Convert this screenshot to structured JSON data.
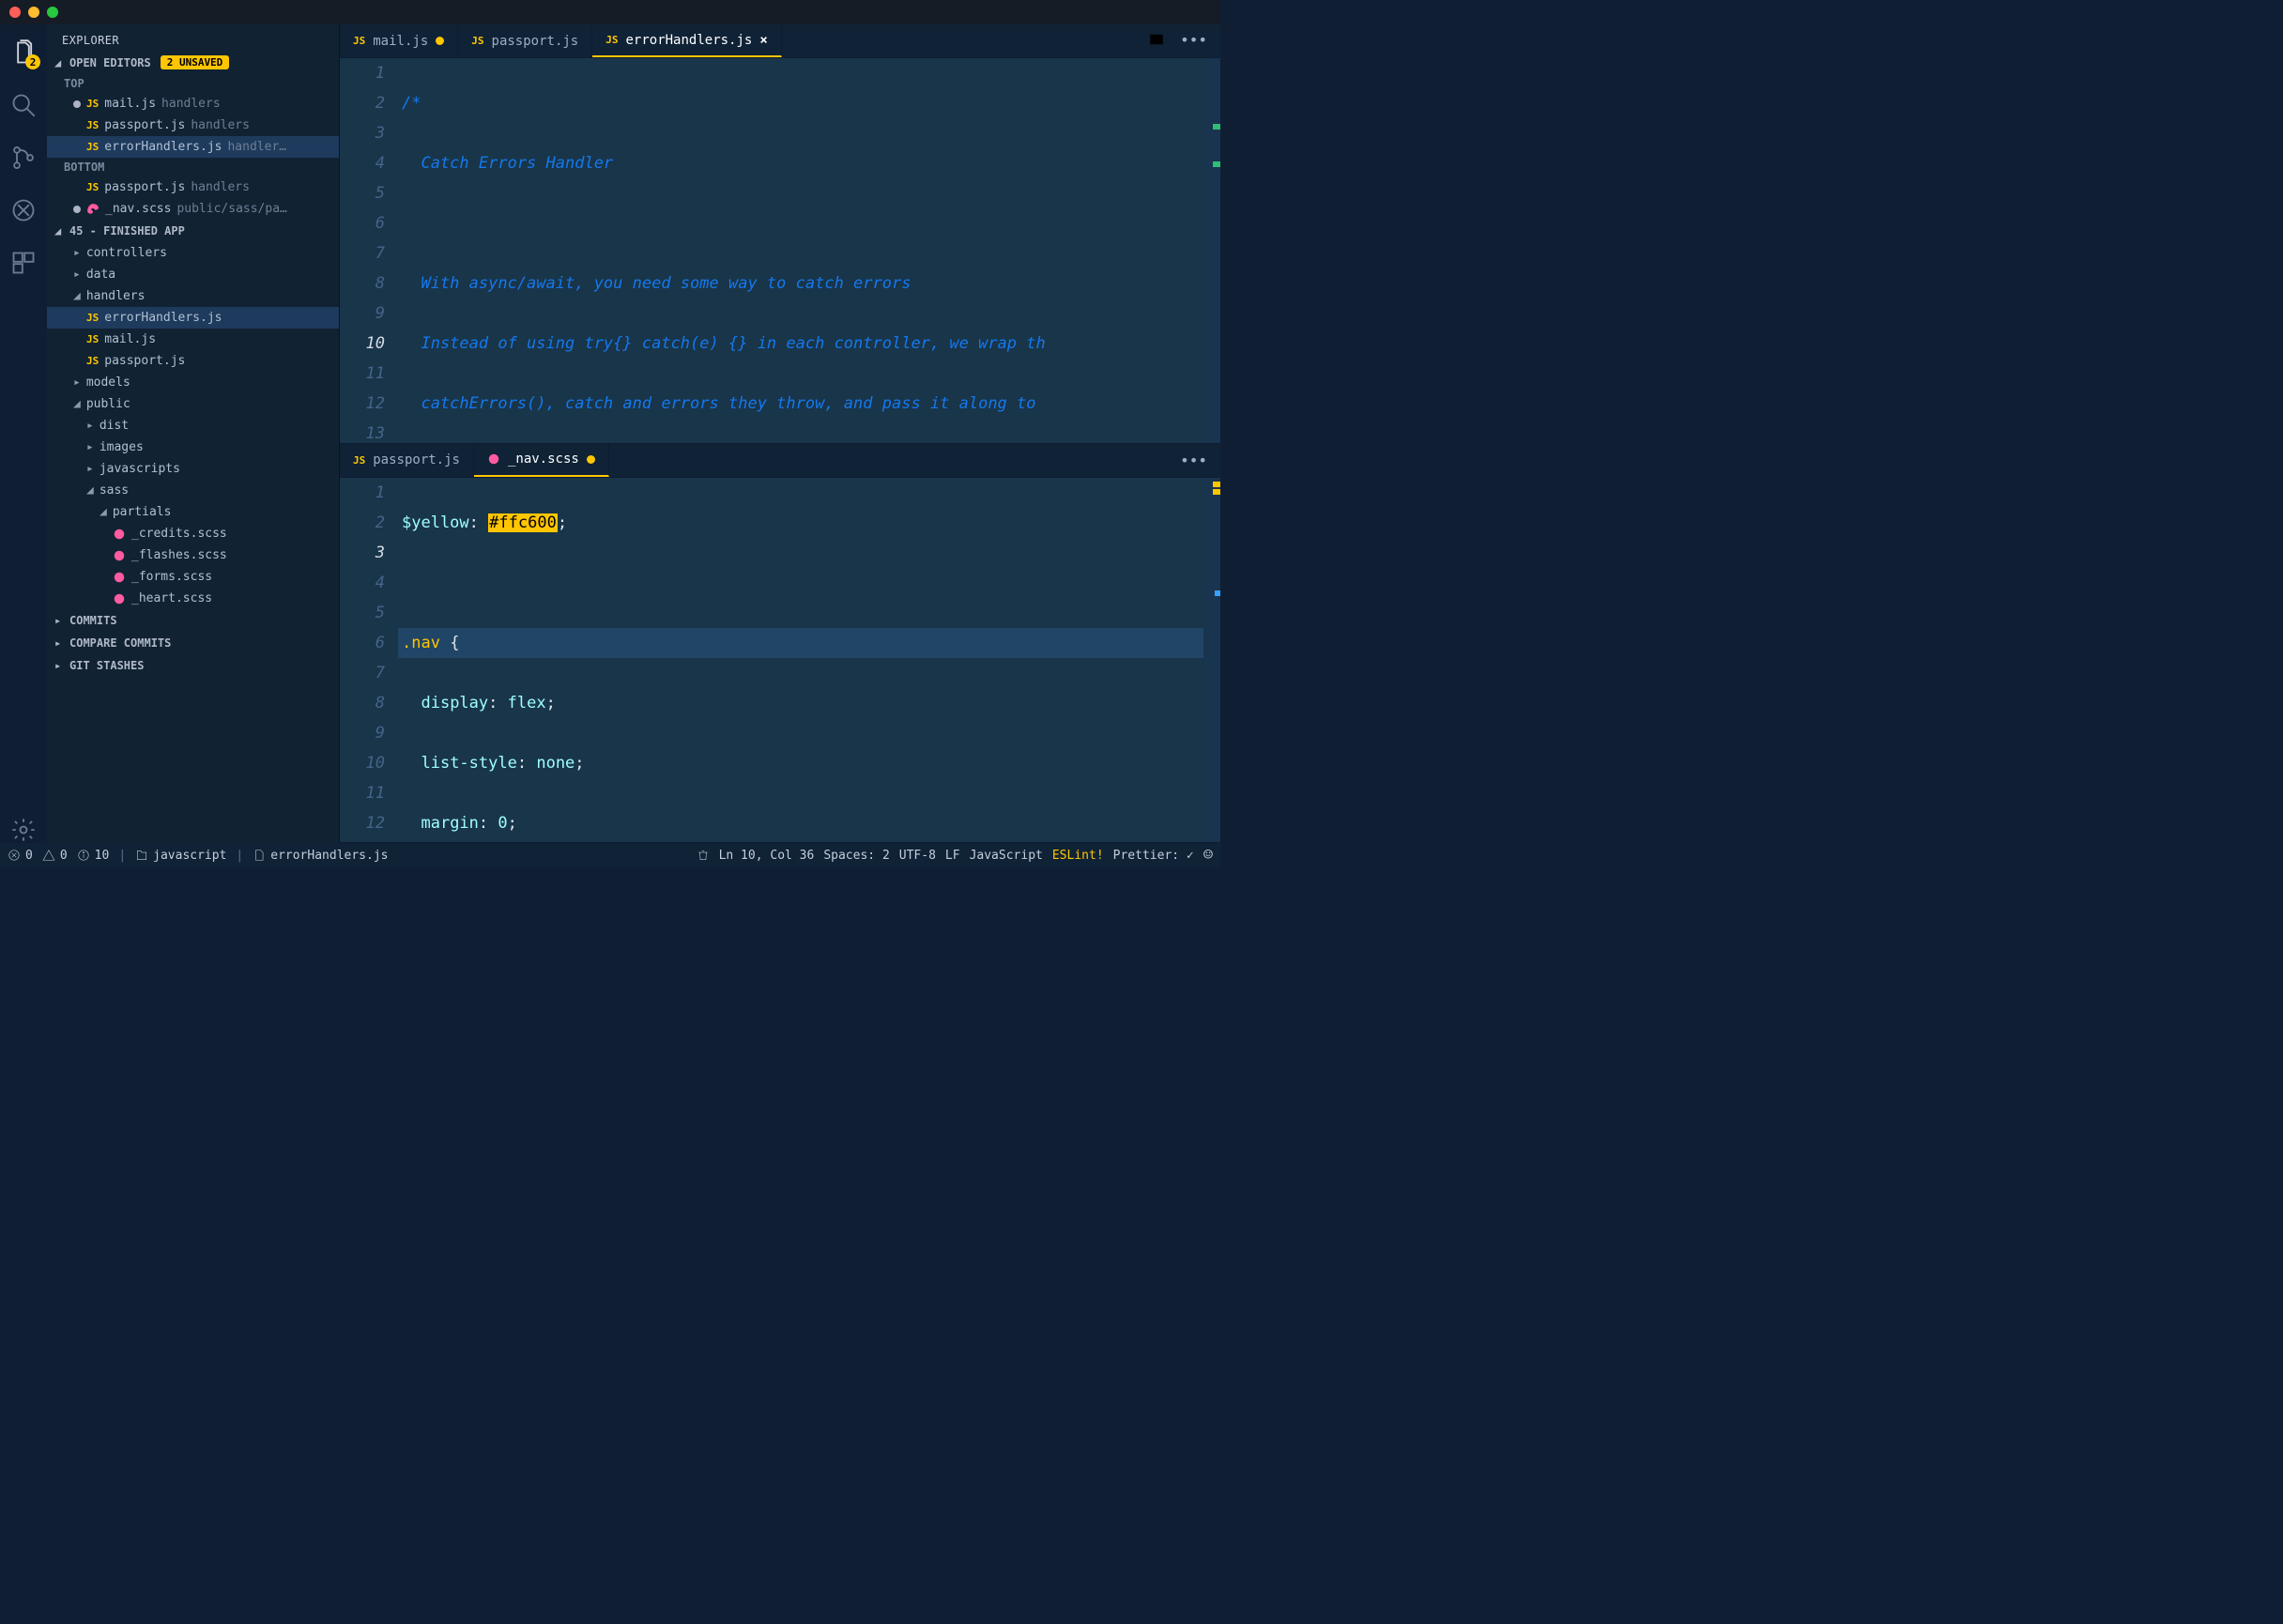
{
  "activity_badge": "2",
  "sidebar": {
    "title": "EXPLORER",
    "open_editors_label": "OPEN EDITORS",
    "unsaved_badge": "2 UNSAVED",
    "group_top_label": "TOP",
    "group_bottom_label": "BOTTOM",
    "open_editors": {
      "top": [
        {
          "file": "mail.js",
          "hint": "handlers",
          "dirty": true,
          "lang": "js"
        },
        {
          "file": "passport.js",
          "hint": "handlers",
          "dirty": false,
          "lang": "js"
        },
        {
          "file": "errorHandlers.js",
          "hint": "handler…",
          "dirty": false,
          "lang": "js",
          "active": true
        }
      ],
      "bottom": [
        {
          "file": "passport.js",
          "hint": "handlers",
          "dirty": false,
          "lang": "js"
        },
        {
          "file": "_nav.scss",
          "hint": "public/sass/pa…",
          "dirty": true,
          "lang": "scss"
        }
      ]
    },
    "project_header": "45 - FINISHED APP",
    "folders": {
      "controllers": "controllers",
      "data": "data",
      "handlers": "handlers",
      "handlers_children": [
        "errorHandlers.js",
        "mail.js",
        "passport.js"
      ],
      "models": "models",
      "public": "public",
      "public_children": {
        "dist": "dist",
        "images": "images",
        "javascripts": "javascripts",
        "sass": "sass",
        "partials": "partials",
        "partials_children": [
          "_credits.scss",
          "_flashes.scss",
          "_forms.scss",
          "_heart.scss"
        ]
      }
    },
    "commits": "COMMITS",
    "compare_commits": "COMPARE COMMITS",
    "git_stashes": "GIT STASHES"
  },
  "editor_top": {
    "tabs": [
      {
        "label": "mail.js",
        "lang": "js",
        "dirty": true
      },
      {
        "label": "passport.js",
        "lang": "js"
      },
      {
        "label": "errorHandlers.js",
        "lang": "js",
        "active": true,
        "close": true
      }
    ],
    "lines": [
      {
        "n": 1,
        "t": [],
        "cls": "comment",
        "raw": "/*"
      },
      {
        "n": 2,
        "cls": "comment",
        "raw": "  Catch Errors Handler"
      },
      {
        "n": 3,
        "cls": "comment",
        "raw": ""
      },
      {
        "n": 4,
        "cls": "comment",
        "raw": "  With async/await, you need some way to catch errors"
      },
      {
        "n": 5,
        "cls": "comment",
        "raw": "  Instead of using try{} catch(e) {} in each controller, we wrap th"
      },
      {
        "n": 6,
        "cls": "comment",
        "raw": "  catchErrors(), catch and errors they throw, and pass it along to "
      },
      {
        "n": 7,
        "cls": "comment",
        "raw": "*/"
      },
      {
        "n": 8,
        "raw": ""
      },
      {
        "n": 9,
        "custom": "line9"
      },
      {
        "n": 10,
        "custom": "line10",
        "cursorline": true
      },
      {
        "n": 11,
        "custom": "line11"
      },
      {
        "n": 12,
        "custom": "line12"
      },
      {
        "n": 13,
        "custom": "line13"
      }
    ]
  },
  "editor_bottom": {
    "tabs": [
      {
        "label": "passport.js",
        "lang": "js"
      },
      {
        "label": "_nav.scss",
        "lang": "scss",
        "active": true,
        "dirty": true
      }
    ],
    "lines": [
      {
        "n": 1,
        "custom": "s1"
      },
      {
        "n": 2,
        "raw": ""
      },
      {
        "n": 3,
        "custom": "s3",
        "cursorline": true
      },
      {
        "n": 4,
        "custom": "s4"
      },
      {
        "n": 5,
        "custom": "s5"
      },
      {
        "n": 6,
        "custom": "s6"
      },
      {
        "n": 7,
        "custom": "s7"
      },
      {
        "n": 8,
        "custom": "s8"
      },
      {
        "n": 9,
        "custom": "s9"
      },
      {
        "n": 10,
        "custom": "s10"
      },
      {
        "n": 11,
        "custom": "s11"
      },
      {
        "n": 12,
        "custom": "s12"
      }
    ]
  },
  "status": {
    "errors": "0",
    "warnings": "0",
    "info": "10",
    "scope": "javascript",
    "filename": "errorHandlers.js",
    "ln_col": "Ln 10, Col 36",
    "spaces": "Spaces: 2",
    "encoding": "UTF-8",
    "eol": "LF",
    "language": "JavaScript",
    "eslint": "ESLint!",
    "prettier": "Prettier: ✓"
  }
}
